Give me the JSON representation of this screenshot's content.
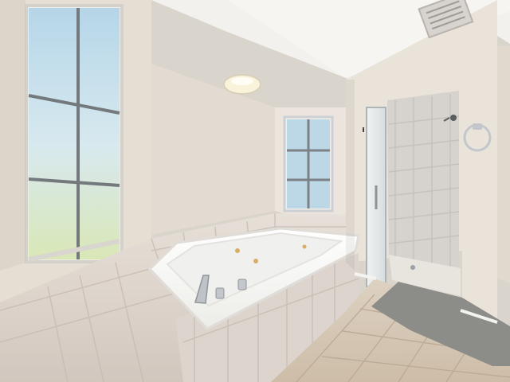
{
  "scene": {
    "subject": "bathroom",
    "colors": {
      "wall": "#e8e0d6",
      "wall_shadow": "#d8cec2",
      "ceiling": "#f2f0ec",
      "tile": "#ddd6cf",
      "tub": "#f7f7f5",
      "floor_tile": "#d6cab9",
      "glass": "#d9dfe3",
      "rug": "#8e8e8a"
    }
  }
}
